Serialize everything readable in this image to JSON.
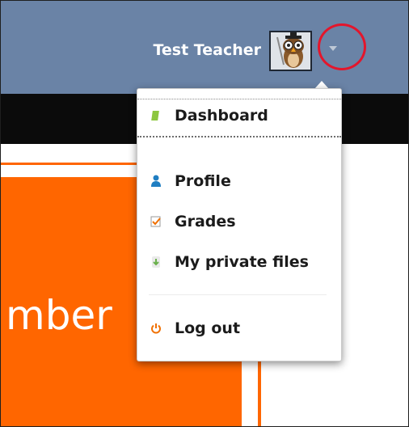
{
  "header": {
    "user_name": "Test Teacher",
    "avatar": "owl-avatar-icon",
    "menu_caret": "chevron-down-icon"
  },
  "page": {
    "partial_text": "mber"
  },
  "user_menu": {
    "items": [
      {
        "label": "Dashboard",
        "icon": "dashboard-icon"
      },
      {
        "label": "Profile",
        "icon": "user-icon"
      },
      {
        "label": "Grades",
        "icon": "grades-icon"
      },
      {
        "label": "My private files",
        "icon": "files-icon"
      },
      {
        "label": "Log out",
        "icon": "power-icon"
      }
    ]
  },
  "colors": {
    "header": "#6a83a6",
    "accent": "#ff6600",
    "highlight_circle": "#e3162c"
  }
}
